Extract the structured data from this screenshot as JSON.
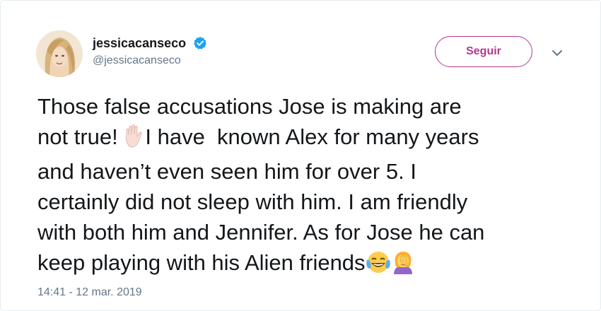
{
  "user": {
    "display_name": "jessicacanseco",
    "handle": "@jessicacanseco",
    "verified": true
  },
  "follow_button_label": "Seguir",
  "icons": {
    "verified": "verified-badge-icon",
    "caret": "chevron-down-icon",
    "hand": "raised-hand-icon",
    "laugh": "face-with-tears-of-joy-icon",
    "facepalm": "person-facepalming-icon"
  },
  "tweet": {
    "line1": "Those false accusations Jose is making are",
    "line2a": "not true! ",
    "line2b": "I have  known Alex for many years",
    "line3": "and haven’t even seen him for over 5. I",
    "line4": "certainly did not sleep with him. I am friendly",
    "line5": "with both him and Jennifer. As for Jose he can",
    "line6": "keep playing with his Alien friends"
  },
  "timestamp": "14:41 - 12 mar. 2019",
  "colors": {
    "follow_accent": "#b0388f",
    "verified_blue": "#1da1f2",
    "secondary_text": "#657786",
    "text": "#14171a"
  }
}
